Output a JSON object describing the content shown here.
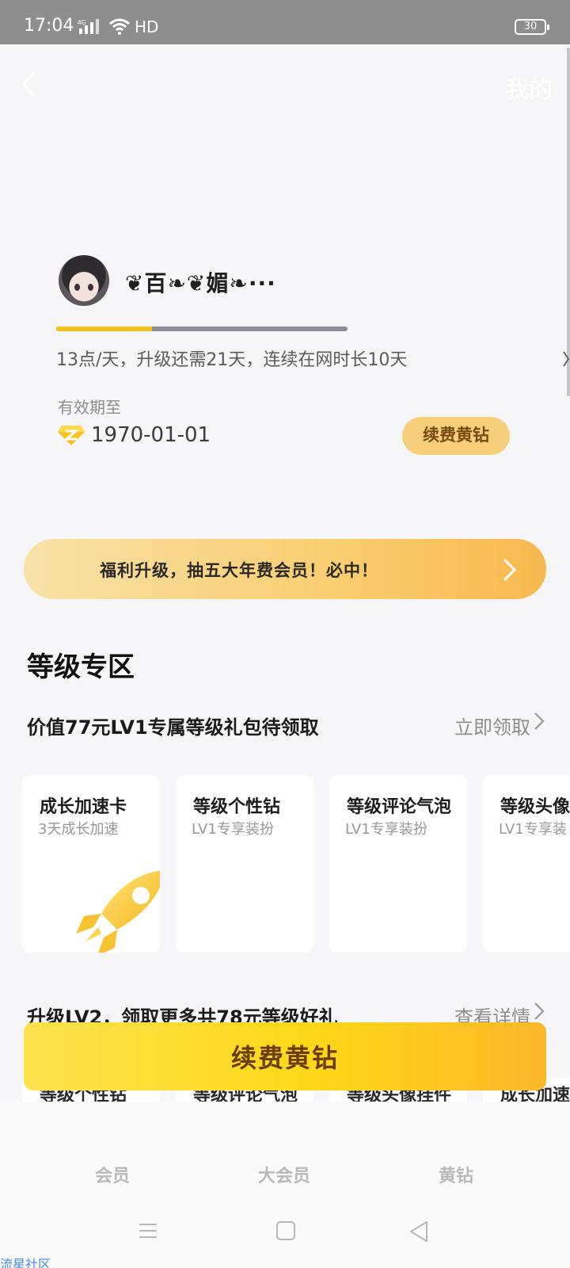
{
  "status_bar": {
    "time": "17:04",
    "network": "HD",
    "battery": "30"
  },
  "nav": {
    "title": "我的"
  },
  "profile": {
    "nickname": "❦百❧❦媚❧···",
    "progress": 0.33,
    "growth_text": "13点/天，升级还需21天，连续在网时长10天",
    "valid_label": "有效期至",
    "valid_date": "1970-01-01",
    "renew_small_label": "续费黄钻"
  },
  "promo": {
    "text": "福利升级，抽五大年费会员！必中！"
  },
  "level_zone": {
    "title": "等级专区",
    "gift_row": {
      "label": "价值77元LV1专属等级礼包待领取",
      "link": "立即领取"
    },
    "cards": [
      {
        "title": "成长加速卡",
        "subtitle": "3天成长加速"
      },
      {
        "title": "等级个性钻",
        "subtitle": "LV1专享装扮"
      },
      {
        "title": "等级评论气泡",
        "subtitle": "LV1专享装扮"
      },
      {
        "title": "等级头像",
        "subtitle": "LV1专享装"
      }
    ],
    "upgrade_row": {
      "label": "升级LV2，领取更多共78元等级好礼",
      "link": "查看详情"
    },
    "peek_cards": [
      "等级个性钻",
      "等级评论气泡",
      "等级头像挂件",
      "成长加速"
    ]
  },
  "renew_big_label": "续费黄钻",
  "tabs": [
    "会员",
    "大会员",
    "黄钻"
  ],
  "watermark": "流星社区",
  "colors": {
    "accent": "#f3c21a",
    "renew_button": "#fdd818",
    "status_bar": "#8e8e8e"
  }
}
